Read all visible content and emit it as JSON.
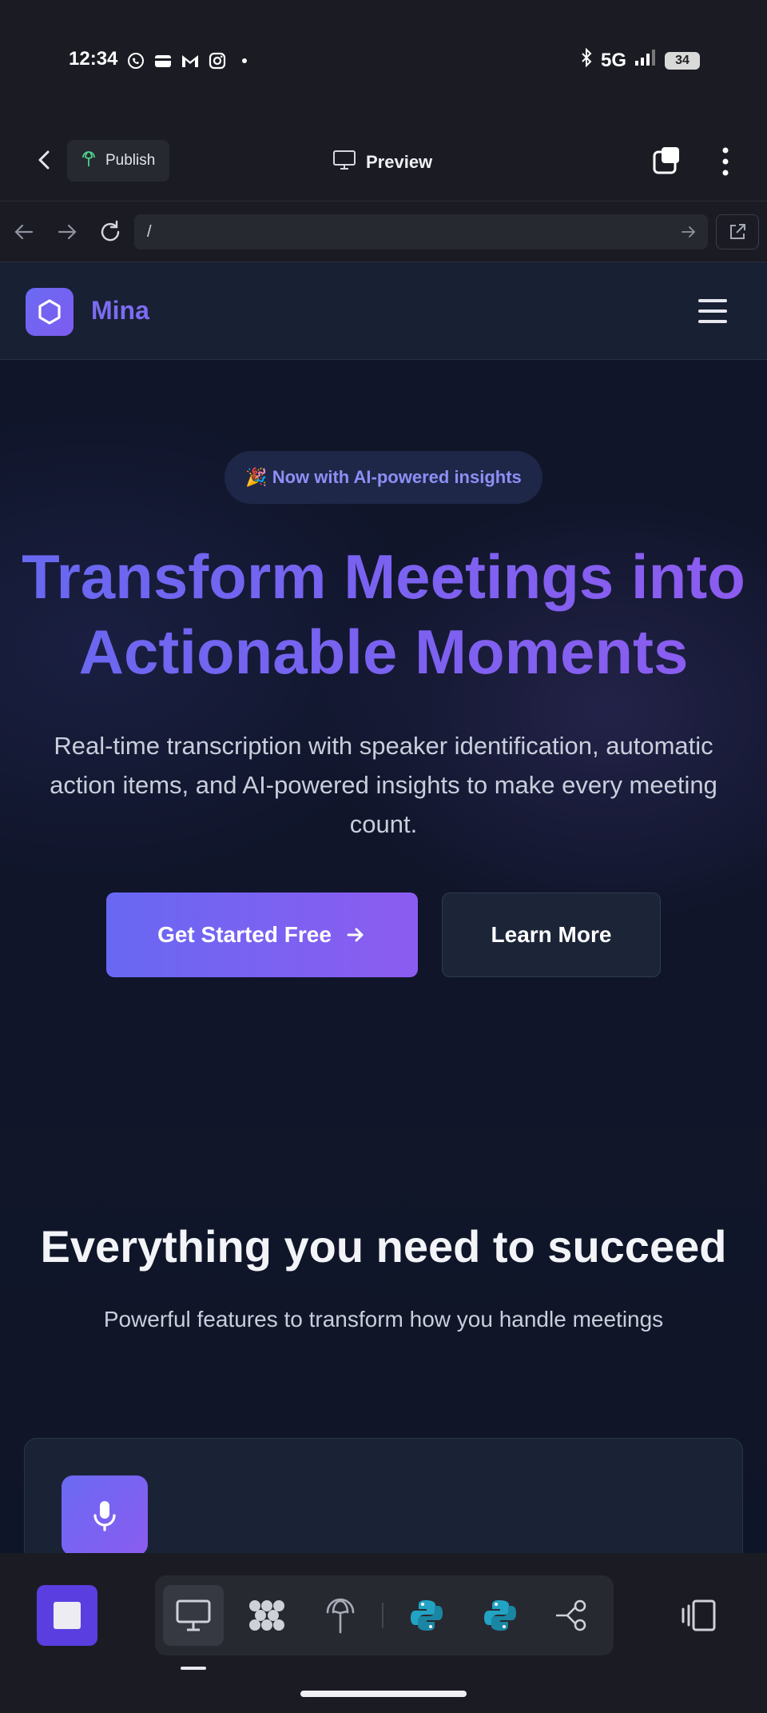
{
  "status_bar": {
    "time": "12:34",
    "network": "5G",
    "battery": "34",
    "app_icons": [
      "whatsapp-icon",
      "wallet-icon",
      "gmail-icon",
      "instagram-icon",
      "dot-icon"
    ]
  },
  "toolbar": {
    "publish_label": "Publish",
    "preview_label": "Preview"
  },
  "url_bar": {
    "value": "/"
  },
  "site": {
    "brand": "Mina",
    "badge": "🎉 Now with AI-powered insights",
    "hero_title": "Transform Meetings into Actionable Moments",
    "hero_subtitle": "Real-time transcription with speaker identification, automatic action items, and AI-powered insights to make every meeting count.",
    "cta_primary": "Get Started Free",
    "cta_secondary": "Learn More",
    "features_title": "Everything you need to succeed",
    "features_subtitle": "Powerful features to transform how you handle meetings"
  },
  "dock": {
    "items": [
      "desktop-icon",
      "grid-icon",
      "publish-icon",
      "python-icon",
      "python-icon",
      "branch-icon"
    ]
  },
  "colors": {
    "accent": "#6a6af3",
    "accent_end": "#8c5cf0",
    "site_bg": "#10152a",
    "chrome_bg": "#1b1c23"
  }
}
